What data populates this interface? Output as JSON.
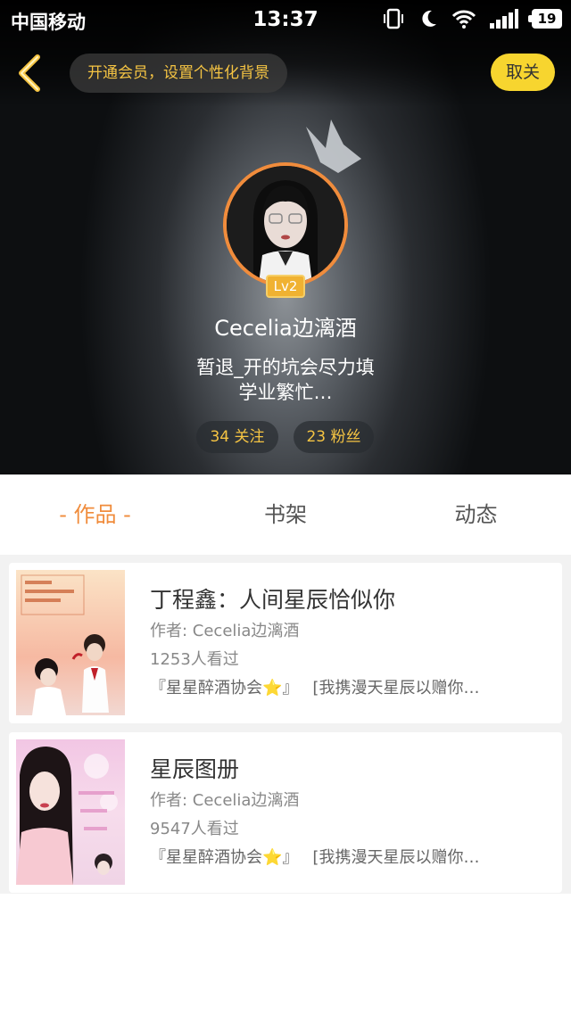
{
  "status_bar": {
    "carrier": "中国移动",
    "time": "13:37",
    "battery": "19"
  },
  "header": {
    "vip_prompt": "开通会员，设置个性化背景",
    "unfollow_label": "取关"
  },
  "profile": {
    "level": "Lv2",
    "username": "Cecelia边漓酒",
    "bio_line1": "暂退_开的坑会尽力填",
    "bio_line2": "学业繁忙…",
    "following": "34 关注",
    "fans": "23 粉丝"
  },
  "tabs": [
    {
      "label": "- 作品 -",
      "active": true
    },
    {
      "label": "书架",
      "active": false
    },
    {
      "label": "动态",
      "active": false
    }
  ],
  "works": [
    {
      "title": "丁程鑫：人间星辰恰似你",
      "author": "作者: Cecelia边漓酒",
      "views": "1253人看过",
      "tag1": "『星星醉酒协会⭐』",
      "tag2": "[我携漫天星辰以赠你…"
    },
    {
      "title": "星辰图册",
      "author": "作者: Cecelia边漓酒",
      "views": "9547人看过",
      "tag1": "『星星醉酒协会⭐』",
      "tag2": "[我携漫天星辰以赠你…"
    }
  ],
  "colors": {
    "accent": "#f08c3c",
    "gold": "#f5c443",
    "unfollow_bg": "#f7d52f"
  }
}
